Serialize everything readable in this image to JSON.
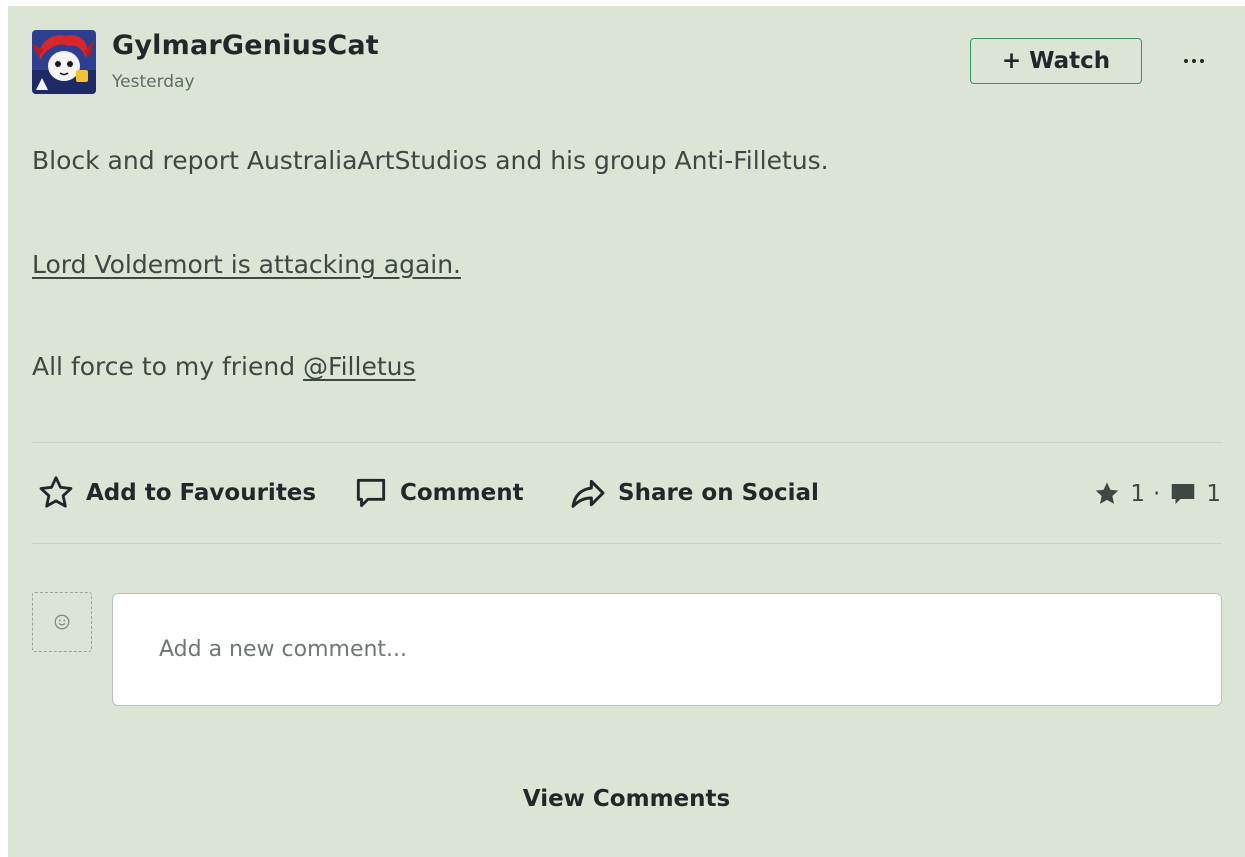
{
  "post": {
    "author": "GylmarGeniusCat",
    "timestamp": "Yesterday",
    "watch_label": "+ Watch",
    "more_icon": "ellipsis-icon",
    "lines": {
      "line1": "Block and report AustraliaArtStudios and his group Anti-Filletus.",
      "line2": "Lord Voldemort is attacking again.",
      "line3_prefix": "All force to my friend ",
      "line3_mention": "@Filletus"
    }
  },
  "actions": {
    "favourite": {
      "label": "Add to Favourites",
      "icon": "star-outline-icon"
    },
    "comment": {
      "label": "Comment",
      "icon": "speech-bubble-icon"
    },
    "share": {
      "label": "Share on Social",
      "icon": "share-arrow-icon"
    }
  },
  "stats": {
    "favourites_count": "1",
    "separator": "·",
    "comments_count": "1"
  },
  "comment_box": {
    "placeholder": "Add a new comment..."
  },
  "footer": {
    "view_comments_label": "View Comments"
  },
  "colors": {
    "card_background": "#dce5d5",
    "watch_border": "#2d9a62",
    "text_dark": "#22272b",
    "text_body": "#3e4744"
  }
}
